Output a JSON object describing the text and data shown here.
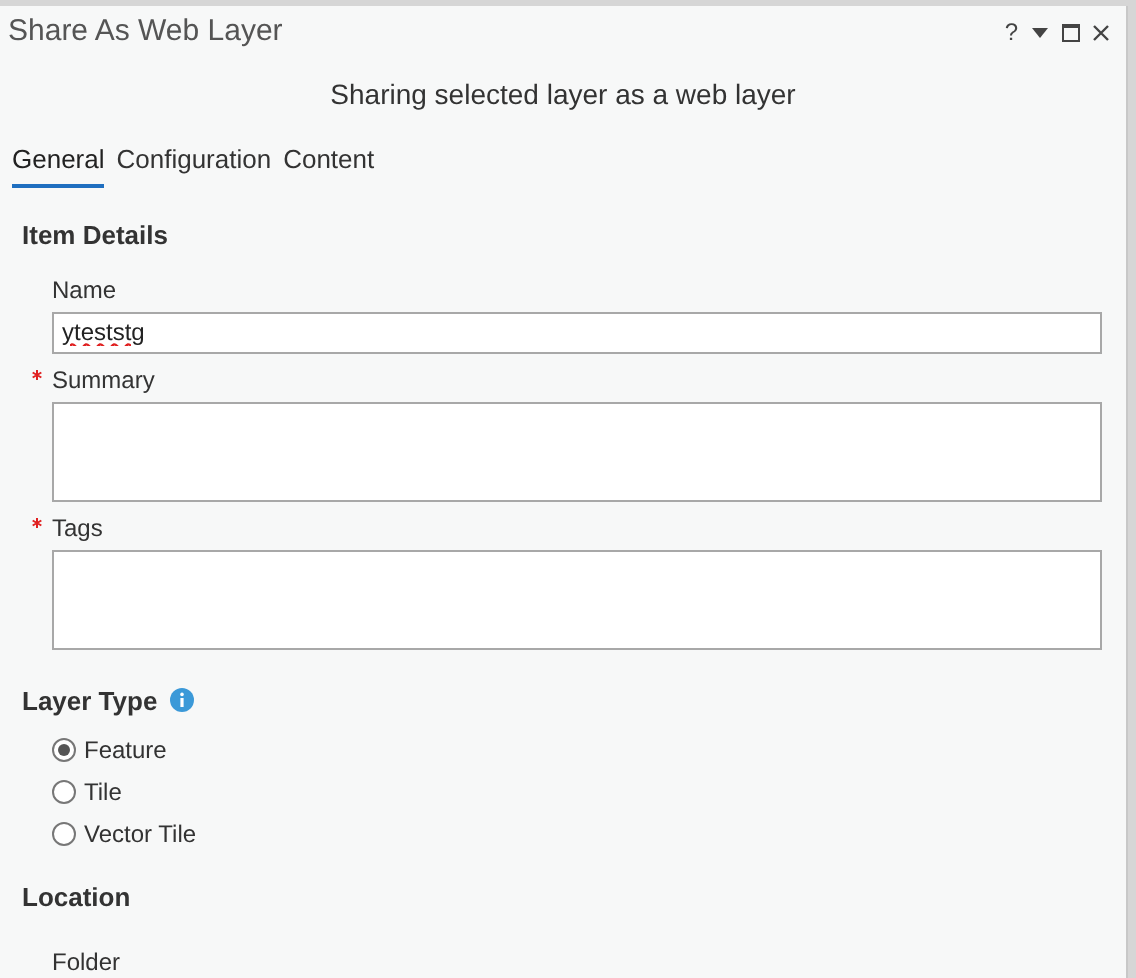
{
  "window": {
    "title": "Share As Web Layer",
    "help": "?"
  },
  "subtitle": "Sharing selected layer as a web layer",
  "tabs": [
    {
      "label": "General",
      "selected": true
    },
    {
      "label": "Configuration",
      "selected": false
    },
    {
      "label": "Content",
      "selected": false
    }
  ],
  "item_details": {
    "heading": "Item Details",
    "fields": [
      {
        "label": "Name",
        "required": false,
        "kind": "line",
        "value": "yteststg"
      },
      {
        "label": "Summary",
        "required": true,
        "kind": "area"
      },
      {
        "label": "Tags",
        "required": true,
        "kind": "area"
      }
    ]
  },
  "layer_type": {
    "heading": "Layer Type",
    "options": [
      {
        "label": "Feature",
        "selected": true
      },
      {
        "label": "Tile",
        "selected": false
      },
      {
        "label": "Vector Tile",
        "selected": false
      }
    ]
  },
  "location": {
    "heading": "Location",
    "fields": [
      {
        "label": "Folder"
      }
    ]
  }
}
